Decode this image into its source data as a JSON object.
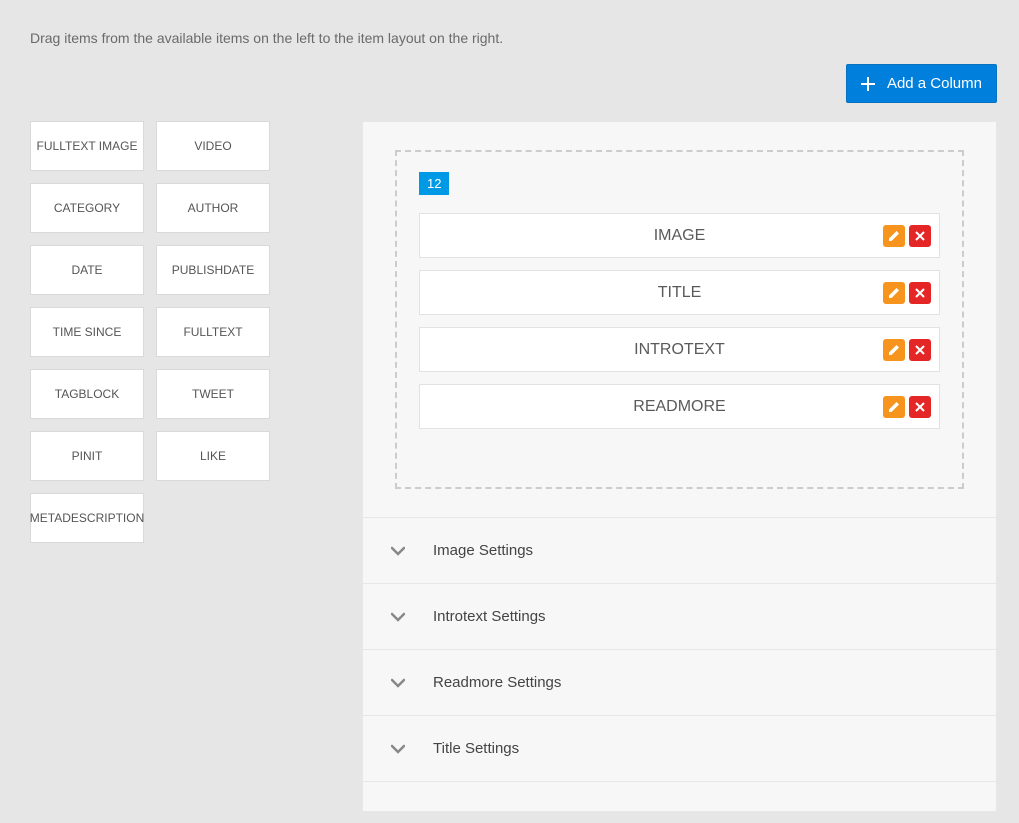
{
  "instructions": "Drag items from the available items on the left to the item layout on the right.",
  "add_column_label": "Add a Column",
  "available_items": {
    "i0": "FULLTEXT IMAGE",
    "i1": "VIDEO",
    "i2": "CATEGORY",
    "i3": "AUTHOR",
    "i4": "DATE",
    "i5": "PUBLISHDATE",
    "i6": "TIME SINCE",
    "i7": "FULLTEXT",
    "i8": "TAGBLOCK",
    "i9": "TWEET",
    "i10": "PINIT",
    "i11": "LIKE",
    "i12": "METADESCRIPTION"
  },
  "column": {
    "width_label": "12",
    "items": {
      "r0": "IMAGE",
      "r1": "TITLE",
      "r2": "INTROTEXT",
      "r3": "READMORE"
    }
  },
  "settings_panels": {
    "p0": "Image Settings",
    "p1": "Introtext Settings",
    "p2": "Readmore Settings",
    "p3": "Title Settings"
  }
}
